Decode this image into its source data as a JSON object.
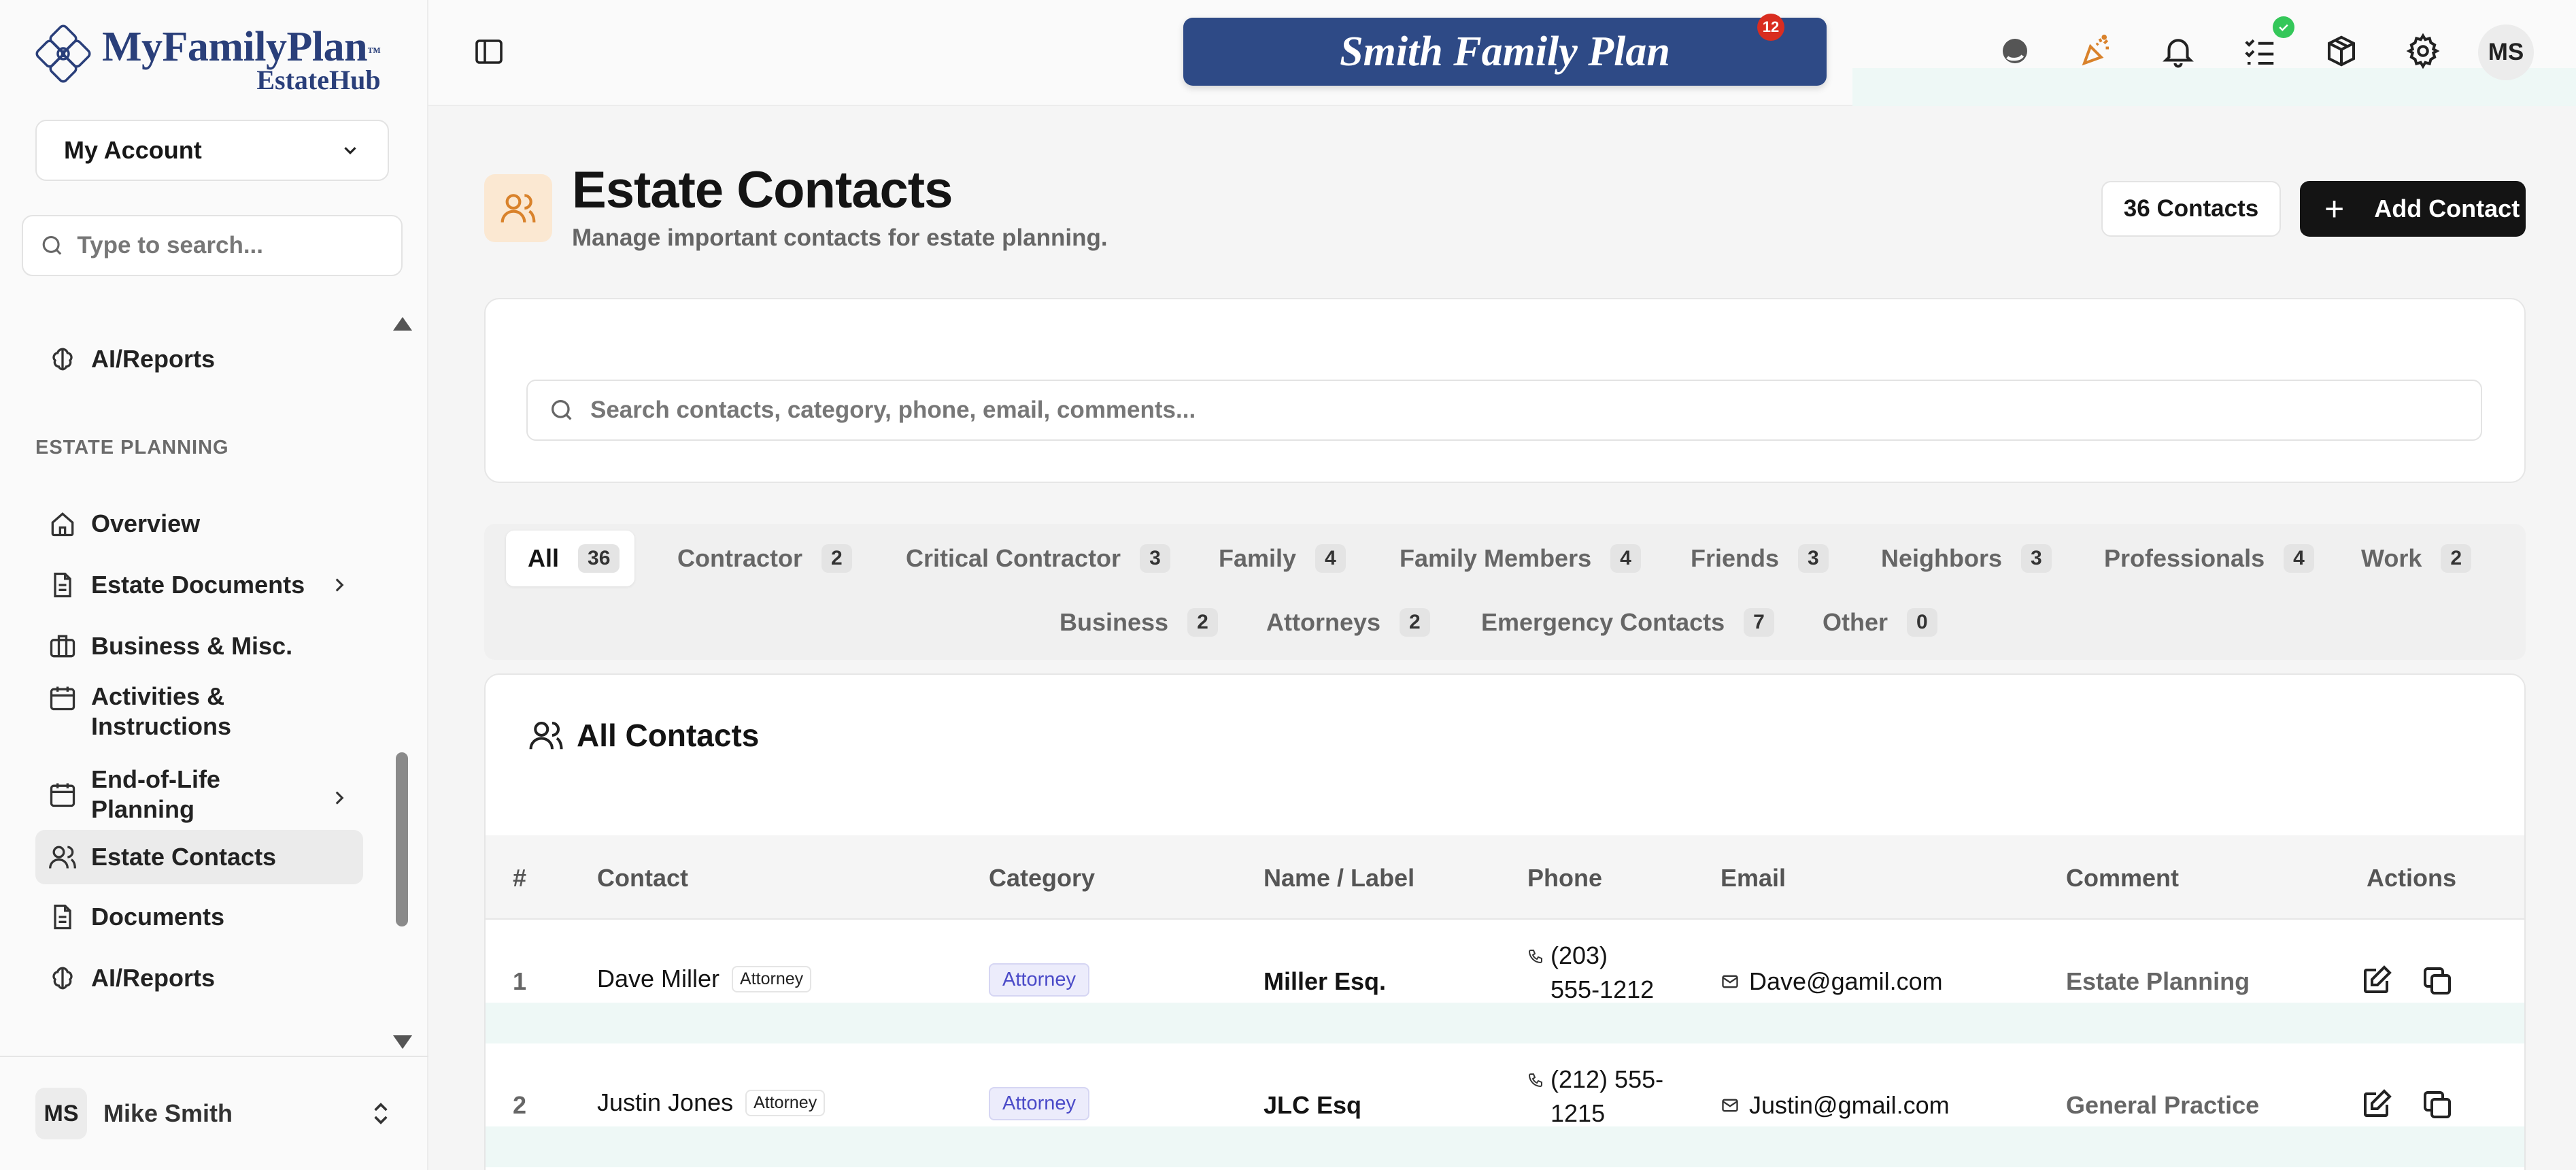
{
  "app": {
    "logo_name": "MyFamilyPlan",
    "logo_tm": "™",
    "logo_sub": "EstateHub",
    "plan_title": "Smith Family Plan"
  },
  "sidebar": {
    "account_select": "My Account",
    "search_placeholder": "Type to search...",
    "top_item": "AI/Reports",
    "section_label": "ESTATE PLANNING",
    "items": [
      {
        "label": "Overview",
        "icon": "home-icon"
      },
      {
        "label": "Estate Documents",
        "icon": "document-icon",
        "has_submenu": true
      },
      {
        "label": "Business & Misc.",
        "icon": "briefcase-icon"
      },
      {
        "label": "Activities & Instructions",
        "icon": "calendar-icon"
      },
      {
        "label": "End-of-Life Planning",
        "icon": "calendar-icon",
        "has_submenu": true
      },
      {
        "label": "Estate Contacts",
        "icon": "users-icon",
        "active": true
      },
      {
        "label": "Documents",
        "icon": "document-icon"
      },
      {
        "label": "AI/Reports",
        "icon": "brain-icon"
      }
    ],
    "user": {
      "initials": "MS",
      "name": "Mike Smith"
    }
  },
  "topbar": {
    "notification_count": "12",
    "avatar_initials": "MS"
  },
  "page": {
    "title": "Estate Contacts",
    "subtitle": "Manage important contacts for estate planning.",
    "count_label": "36 Contacts",
    "add_button": "Add Contact",
    "search_placeholder": "Search contacts, category, phone, email, comments..."
  },
  "tabs": [
    {
      "label": "All",
      "count": "36",
      "active": true
    },
    {
      "label": "Contractor",
      "count": "2"
    },
    {
      "label": "Critical Contractor",
      "count": "3"
    },
    {
      "label": "Family",
      "count": "4"
    },
    {
      "label": "Family Members",
      "count": "4"
    },
    {
      "label": "Friends",
      "count": "3"
    },
    {
      "label": "Neighbors",
      "count": "3"
    },
    {
      "label": "Professionals",
      "count": "4"
    },
    {
      "label": "Work",
      "count": "2"
    },
    {
      "label": "Business",
      "count": "2"
    },
    {
      "label": "Attorneys",
      "count": "2"
    },
    {
      "label": "Emergency Contacts",
      "count": "7"
    },
    {
      "label": "Other",
      "count": "0"
    }
  ],
  "table": {
    "title": "All Contacts",
    "columns": [
      "#",
      "Contact",
      "Category",
      "Name / Label",
      "Phone",
      "Email",
      "Comment",
      "Actions"
    ],
    "rows": [
      {
        "num": "1",
        "contact": "Dave Miller",
        "tag": "Attorney",
        "category": "Attorney",
        "label": "Miller Esq.",
        "phone_1": "(203)",
        "phone_2": "555-1212",
        "email": "Dave@gamil.com",
        "comment": "Estate Planning"
      },
      {
        "num": "2",
        "contact": "Justin Jones",
        "tag": "Attorney",
        "category": "Attorney",
        "label": "JLC Esq",
        "phone_1": "(212) 555-",
        "phone_2": "1215",
        "email": "Justin@gmail.com",
        "comment": "General Practice"
      }
    ]
  },
  "colors": {
    "brand_navy": "#2e4a86",
    "logo_text": "#2a3f7a",
    "accent_orange": "#d9822b",
    "badge_red": "#d92d20",
    "check_green": "#34c759",
    "category_badge": "#4b4bc8"
  }
}
